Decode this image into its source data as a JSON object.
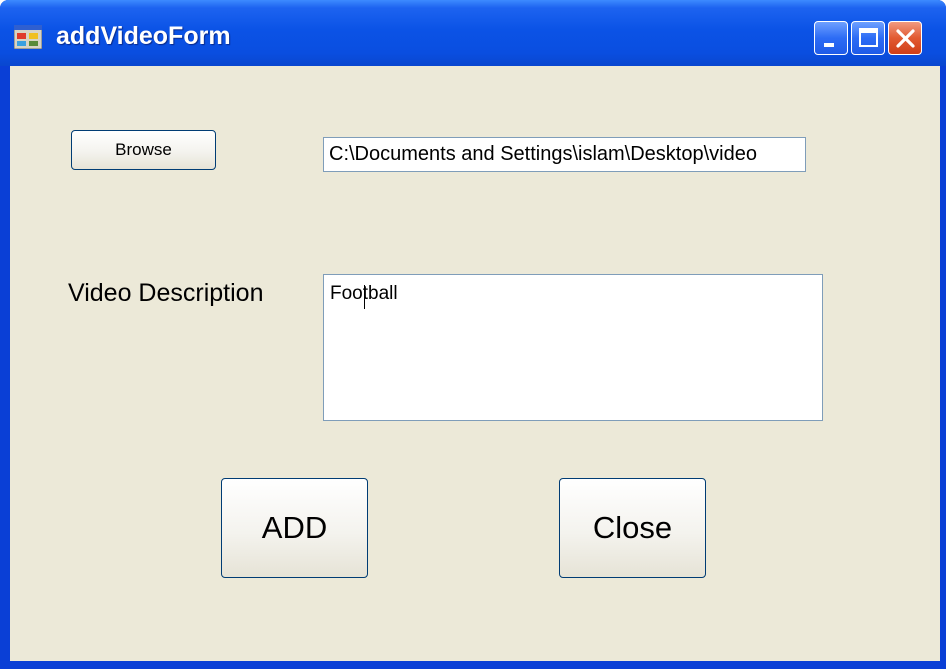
{
  "window": {
    "title": "addVideoForm",
    "icon": "form-app-icon",
    "controls": {
      "minimize_icon": "minimize-icon",
      "maximize_icon": "maximize-icon",
      "close_icon": "close-icon"
    }
  },
  "form": {
    "browse_label": "Browse",
    "path_value": "C:\\Documents and Settings\\islam\\Desktop\\video",
    "description_label": "Video Description",
    "description_value": "Football",
    "add_label": "ADD",
    "close_label": "Close"
  },
  "colors": {
    "titlebar": "#0a53e4",
    "client_background": "#ece9d8",
    "button_border": "#003c74",
    "textbox_border": "#7f9db9",
    "close_button": "#e25a32"
  }
}
